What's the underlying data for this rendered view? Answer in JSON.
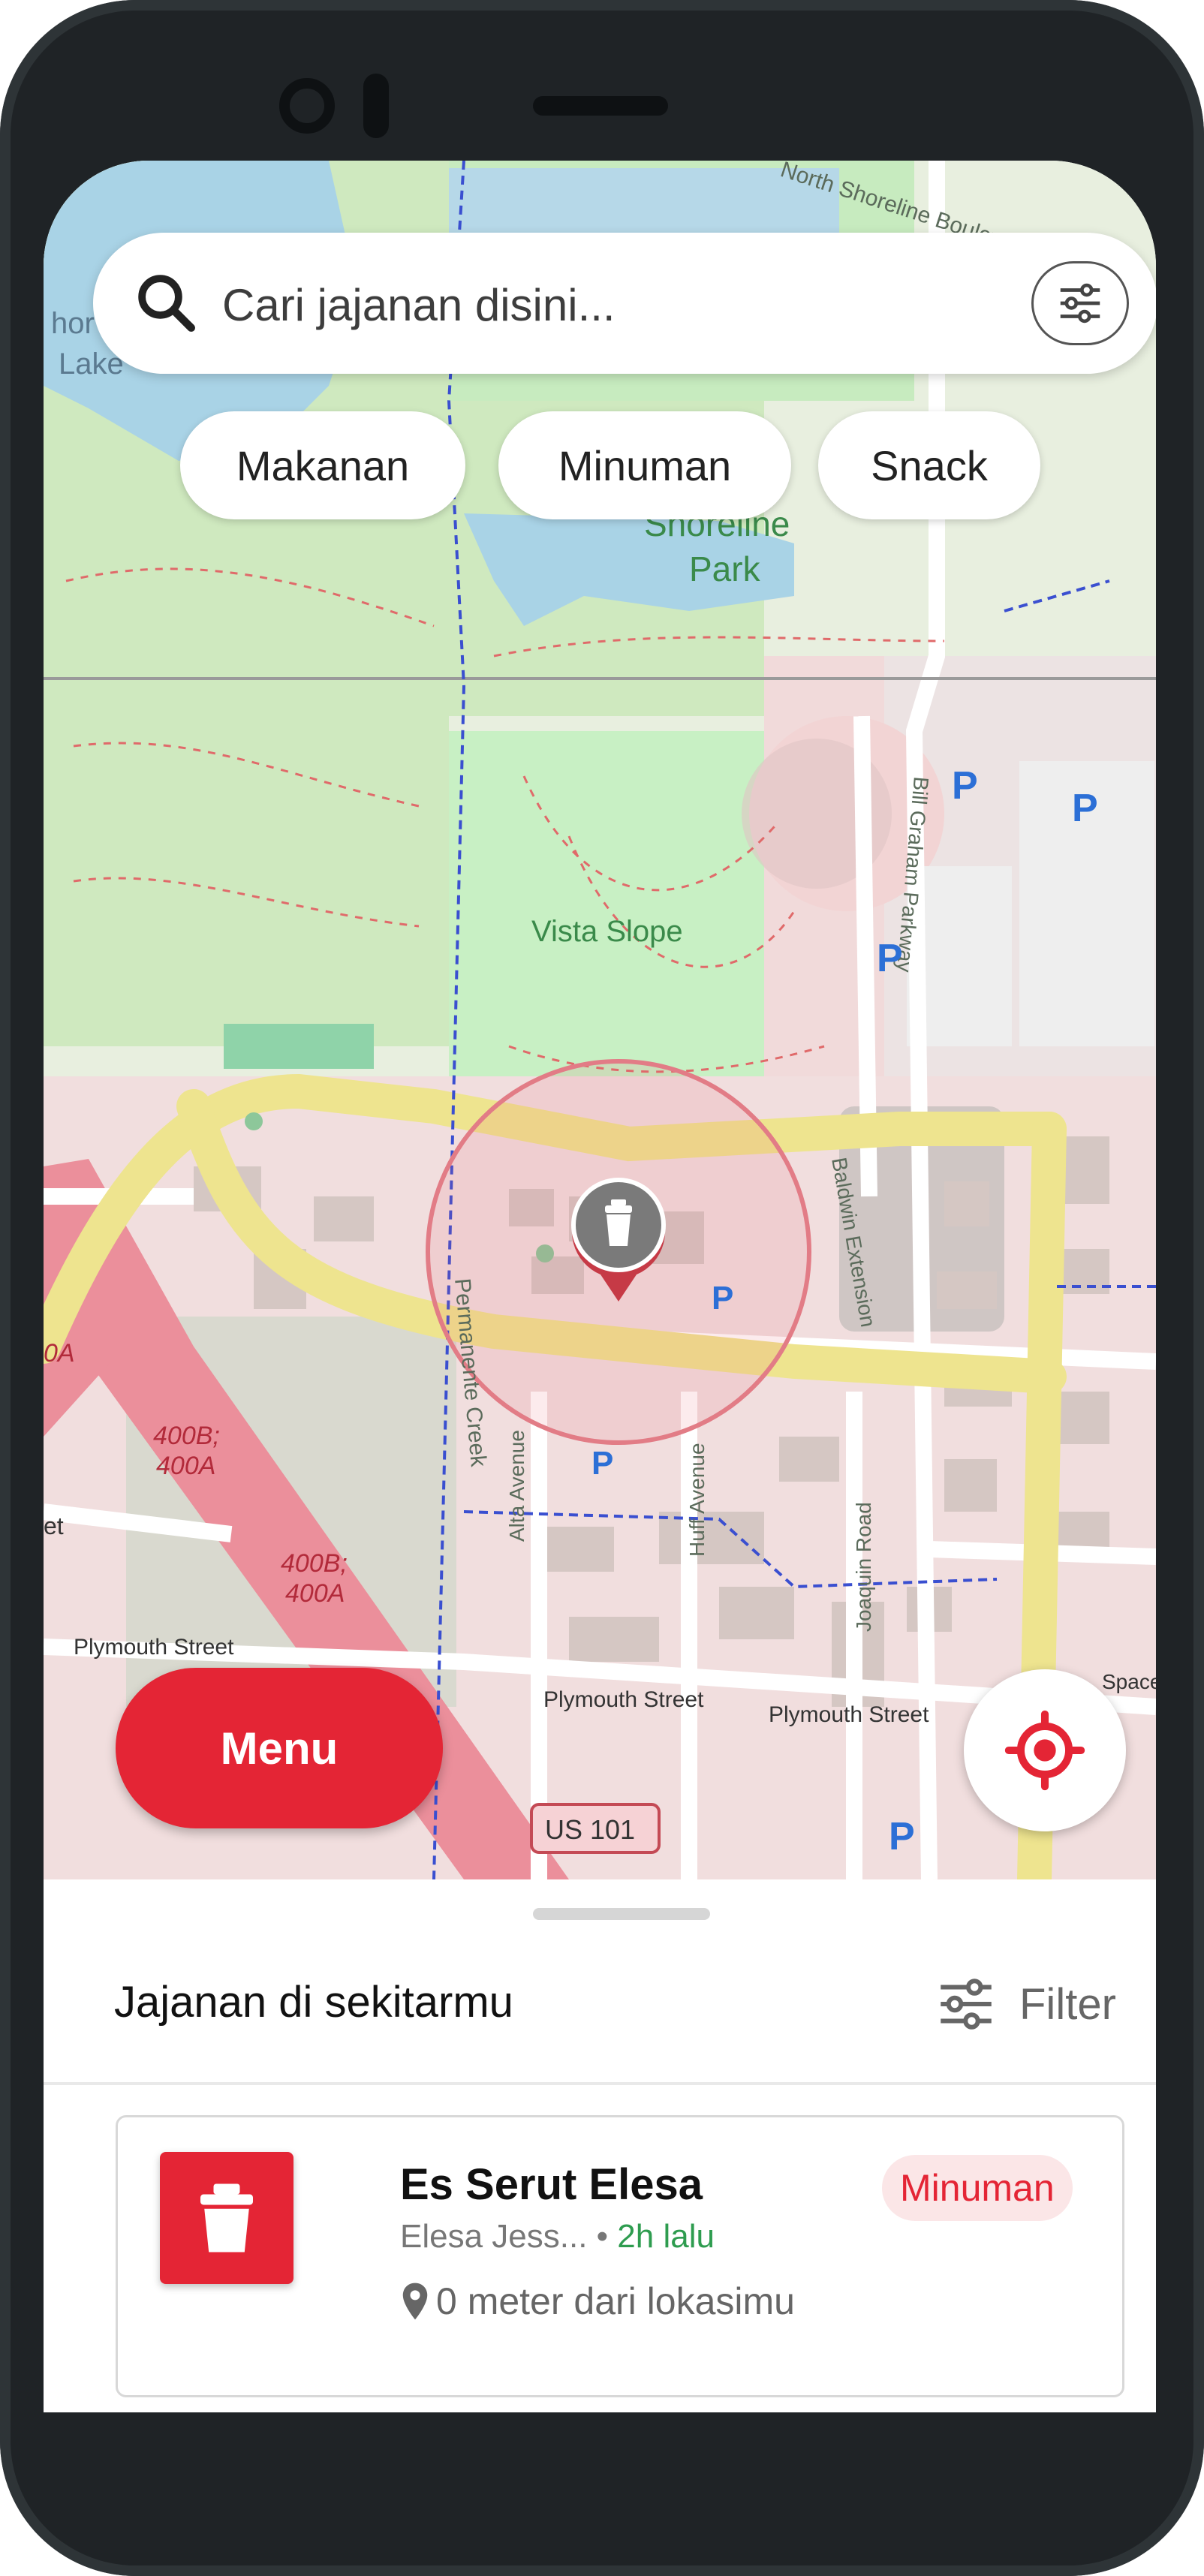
{
  "search": {
    "placeholder": "Cari jajanan disini...",
    "icon": "search-icon",
    "filter_icon": "sliders-icon"
  },
  "chips": [
    {
      "label": "Makanan"
    },
    {
      "label": "Minuman"
    },
    {
      "label": "Snack"
    }
  ],
  "map": {
    "labels": {
      "boulevard": "North Shoreline Boulevard",
      "lake_1": "hor",
      "lake_2": "Lake",
      "park_1": "Shoreline",
      "park_2": "Park",
      "vista": "Vista Slope",
      "bill_graham": "Bill Graham Parkway",
      "baldwin": "Baldwin Extension",
      "permanente": "Permanente Creek",
      "alta": "Alta Avenue",
      "huff": "Huff Avenue",
      "joaquin": "Joaquin Road",
      "plymouth_1": "Plymouth Street",
      "plymouth_2": "Plymouth Street",
      "plymouth_3": "Plymouth Street",
      "exit_1a": "400B;",
      "exit_1b": "400A",
      "exit_2a": "400B;",
      "exit_2b": "400A",
      "exit_3": "0A",
      "et": "et",
      "space": "Space",
      "us101": "US 101",
      "parking": "P"
    },
    "marker_icon": "cup-icon"
  },
  "menu_button": {
    "label": "Menu"
  },
  "locate_button": {
    "icon": "target-icon"
  },
  "sheet": {
    "title": "Jajanan di sekitarmu",
    "filter_label": "Filter",
    "items": [
      {
        "name": "Es Serut Elesa",
        "seller": "Elesa Jess...",
        "separator": " • ",
        "time": "2h lalu",
        "category": "Minuman",
        "distance": "0 meter dari lokasimu",
        "icon": "cup-icon"
      }
    ]
  },
  "colors": {
    "accent": "#e42535",
    "badge_bg": "#fbe6e7",
    "time_green": "#2e9c4f",
    "map_green": "#c8ecc0",
    "map_road_yellow": "#f4f0a0",
    "map_urban": "#f2dada"
  }
}
